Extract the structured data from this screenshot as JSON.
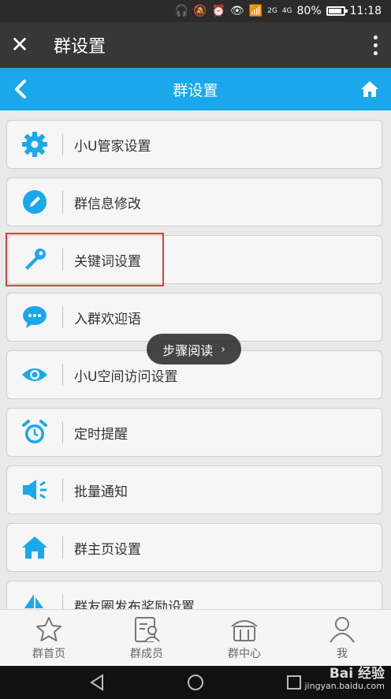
{
  "status_bar": {
    "network_2g": "2G",
    "network_4g": "4G",
    "battery": "80%",
    "time": "11:18"
  },
  "app_bar": {
    "title": "群设置"
  },
  "blue_nav": {
    "title": "群设置"
  },
  "settings": [
    {
      "label": "小U管家设置",
      "icon": "gear-icon"
    },
    {
      "label": "群信息修改",
      "icon": "pencil-icon"
    },
    {
      "label": "关键词设置",
      "icon": "key-icon"
    },
    {
      "label": "入群欢迎语",
      "icon": "chat-bubble-icon"
    },
    {
      "label": "小U空间访问设置",
      "icon": "eye-icon"
    },
    {
      "label": "定时提醒",
      "icon": "alarm-clock-icon"
    },
    {
      "label": "批量通知",
      "icon": "speaker-icon"
    },
    {
      "label": "群主页设置",
      "icon": "home-icon"
    },
    {
      "label": "群友圈发布奖励设置",
      "icon": "boat-icon"
    }
  ],
  "floating_pill": {
    "label": "步骤阅读"
  },
  "tabs": [
    {
      "label": "群首页",
      "icon": "star-icon"
    },
    {
      "label": "群成员",
      "icon": "member-card-icon"
    },
    {
      "label": "群中心",
      "icon": "building-icon"
    },
    {
      "label": "我",
      "icon": "user-icon"
    }
  ],
  "watermark": {
    "brand": "Bai 经验",
    "url": "jingyan.baidu.com"
  },
  "colors": {
    "accent": "#1aa8ec",
    "highlight": "#e23b3b",
    "dark": "#373737"
  }
}
